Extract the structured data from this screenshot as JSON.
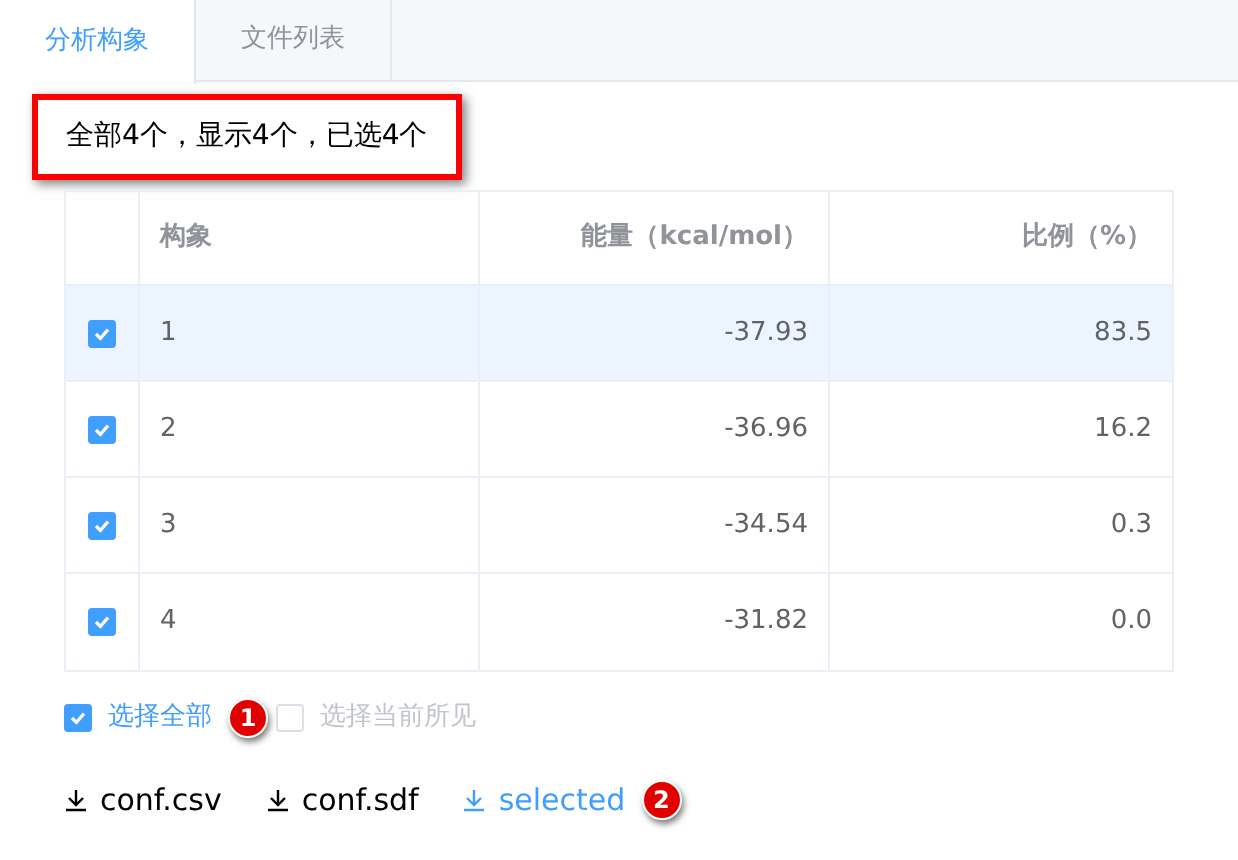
{
  "tabs": [
    {
      "label": "分析构象",
      "selected": true
    },
    {
      "label": "文件列表",
      "selected": false
    }
  ],
  "summary": "全部4个，显示4个，已选4个",
  "table": {
    "columns": [
      "构象",
      "能量（kcal/mol）",
      "比例（%）"
    ],
    "rows": [
      {
        "checked": true,
        "selected": true,
        "cells": [
          "1",
          "-37.93",
          "83.5"
        ]
      },
      {
        "checked": true,
        "selected": false,
        "cells": [
          "2",
          "-36.96",
          "16.2"
        ]
      },
      {
        "checked": true,
        "selected": false,
        "cells": [
          "3",
          "-34.54",
          "0.3"
        ]
      },
      {
        "checked": true,
        "selected": false,
        "cells": [
          "4",
          "-31.82",
          "0.0"
        ]
      }
    ]
  },
  "options": [
    {
      "label": "选择全部",
      "checked": true,
      "badge": "1"
    },
    {
      "label": "选择当前所见",
      "checked": false
    }
  ],
  "downloads": [
    {
      "label": "conf.csv",
      "highlighted": false
    },
    {
      "label": "conf.sdf",
      "highlighted": false
    },
    {
      "label": "selected",
      "highlighted": true,
      "badge": "2"
    }
  ]
}
